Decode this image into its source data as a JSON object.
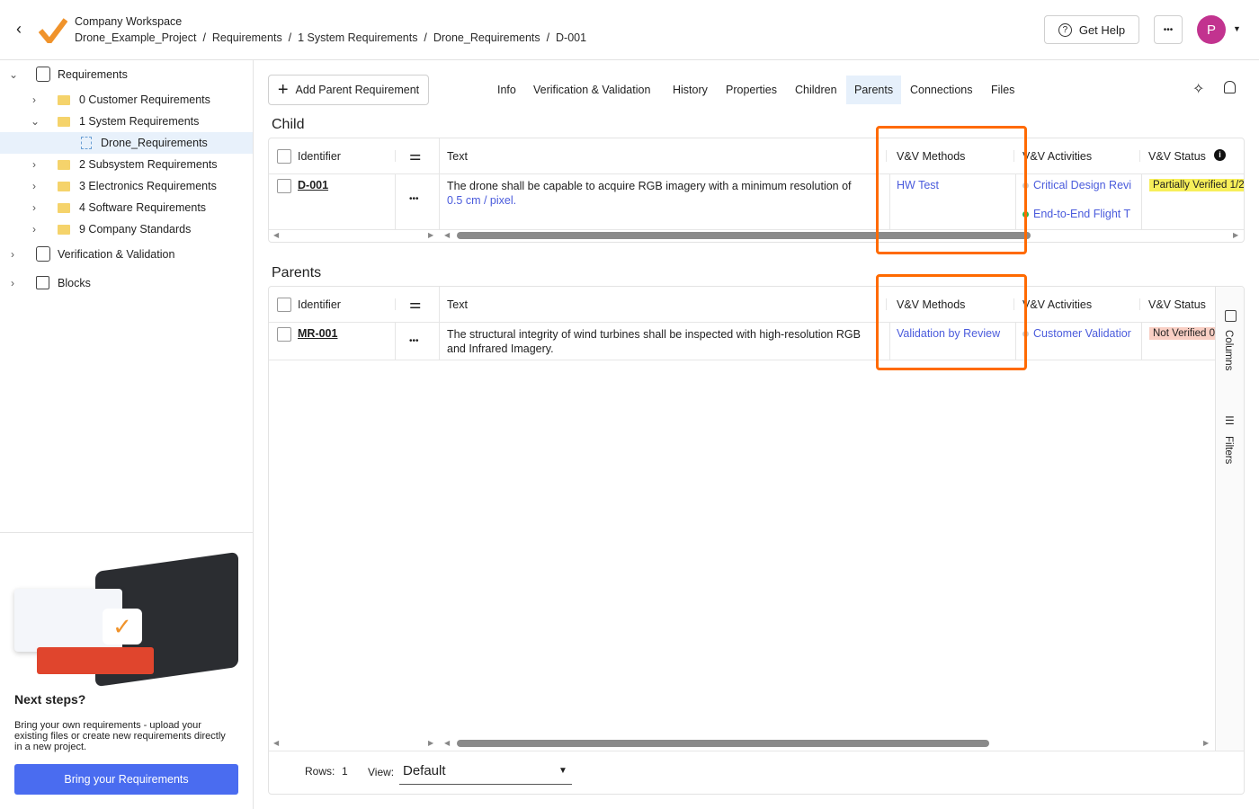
{
  "header": {
    "workspace": "Company Workspace",
    "breadcrumb": [
      "Drone_Example_Project",
      "Requirements",
      "1 System Requirements",
      "Drone_Requirements",
      "D-001"
    ],
    "get_help": "Get Help",
    "avatar": "P",
    "accent": "#c2338f"
  },
  "sidebar": {
    "items": [
      {
        "label": "Requirements",
        "level": 0,
        "expanded": true
      },
      {
        "label": "0 Customer Requirements",
        "level": 1
      },
      {
        "label": "1 System Requirements",
        "level": 1,
        "expanded": true
      },
      {
        "label": "Drone_Requirements",
        "level": 2,
        "selected": true
      },
      {
        "label": "2 Subsystem Requirements",
        "level": 1
      },
      {
        "label": "3 Electronics Requirements",
        "level": 1
      },
      {
        "label": "4 Software Requirements",
        "level": 1
      },
      {
        "label": "9 Company Standards",
        "level": 1
      },
      {
        "label": "Verification & Validation",
        "level": 0
      },
      {
        "label": "Blocks",
        "level": 0
      }
    ],
    "promo": {
      "title": "Next steps?",
      "text": "Bring your own requirements - upload your existing files or create new requirements directly in a new project.",
      "button": "Bring your Requirements"
    }
  },
  "toolbar": {
    "add_parent": "Add Parent Requirement",
    "tabs": [
      "Info",
      "Verification & Validation",
      "History",
      "Properties",
      "Children",
      "Parents",
      "Connections",
      "Files"
    ],
    "active_tab": "Parents"
  },
  "child": {
    "title": "Child",
    "columns": [
      "Identifier",
      "Text",
      "V&V Methods",
      "V&V Activities",
      "V&V Status"
    ],
    "row": {
      "id": "D-001",
      "text": "The drone shall be capable to acquire RGB imagery with a minimum resolution of",
      "text_link": "0.5  cm / pixel.",
      "methods": "HW Test",
      "activities": [
        "Critical Design Revi",
        "End-to-End Flight T"
      ],
      "status": "Partially Verified 1/2"
    }
  },
  "parents": {
    "title": "Parents",
    "columns": [
      "Identifier",
      "Text",
      "V&V Methods",
      "V&V Activities",
      "V&V Status"
    ],
    "row": {
      "id": "MR-001",
      "text": "The structural integrity of wind turbines shall be inspected with high-resolution RGB and Infrared Imagery.",
      "methods": "Validation by Review",
      "activities": [
        "Customer Validatior"
      ],
      "status": "Not Verified 0"
    },
    "side": [
      "Columns",
      "Filters"
    ],
    "rows_label": "Rows:",
    "rows": "1",
    "view_label": "View:",
    "view": "Default"
  }
}
